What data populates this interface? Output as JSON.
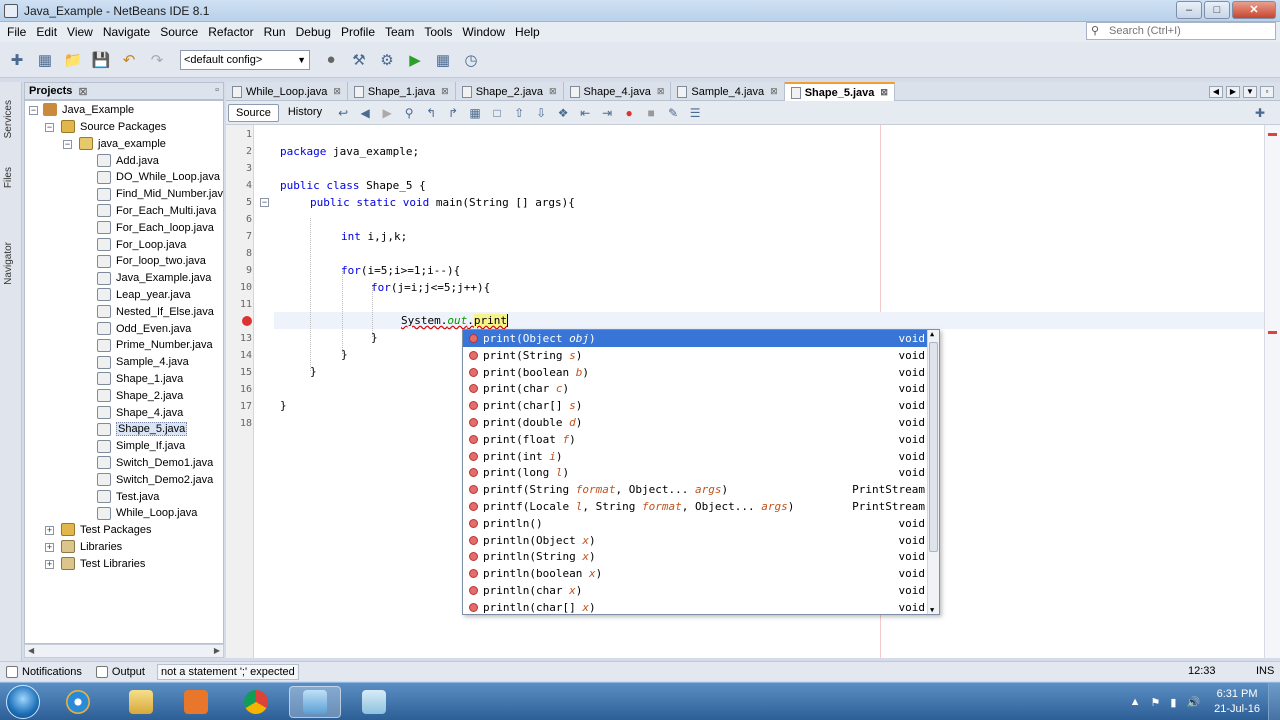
{
  "window": {
    "title": "Java_Example - NetBeans IDE 8.1",
    "min": "‒",
    "max": "□",
    "close": "✕"
  },
  "menu": [
    "File",
    "Edit",
    "View",
    "Navigate",
    "Source",
    "Refactor",
    "Run",
    "Debug",
    "Profile",
    "Team",
    "Tools",
    "Window",
    "Help"
  ],
  "search": {
    "placeholder": "Search (Ctrl+I)"
  },
  "toolbar": {
    "config": "<default config>"
  },
  "side_labels": {
    "services": "Services",
    "files": "Files",
    "navigator": "Navigator"
  },
  "projects": {
    "title": "Projects",
    "root": "Java_Example",
    "source_packages": "Source Packages",
    "package": "java_example",
    "files": [
      "Add.java",
      "DO_While_Loop.java",
      "Find_Mid_Number.java",
      "For_Each_Multi.java",
      "For_Each_loop.java",
      "For_Loop.java",
      "For_loop_two.java",
      "Java_Example.java",
      "Leap_year.java",
      "Nested_If_Else.java",
      "Odd_Even.java",
      "Prime_Number.java",
      "Sample_4.java",
      "Shape_1.java",
      "Shape_2.java",
      "Shape_4.java",
      "Shape_5.java",
      "Simple_If.java",
      "Switch_Demo1.java",
      "Switch_Demo2.java",
      "Test.java",
      "While_Loop.java"
    ],
    "selected_file": "Shape_5.java",
    "test_packages": "Test Packages",
    "libraries": "Libraries",
    "test_libraries": "Test Libraries"
  },
  "tabs": [
    "While_Loop.java",
    "Shape_1.java",
    "Shape_2.java",
    "Shape_4.java",
    "Sample_4.java",
    "Shape_5.java"
  ],
  "active_tab": "Shape_5.java",
  "editor": {
    "source_btn": "Source",
    "history_btn": "History",
    "line_numbers": [
      "1",
      "2",
      "3",
      "4",
      "5",
      "6",
      "7",
      "8",
      "9",
      "10",
      "11",
      "",
      "13",
      "14",
      "15",
      "16",
      "17",
      "18"
    ],
    "lines": {
      "l2": {
        "kw": "package",
        "rest": " java_example;"
      },
      "l4": {
        "kw": "public class",
        "name": " Shape_5 ",
        "brace": "{"
      },
      "l5": {
        "kw": "public static void",
        "name": " main",
        "rest": "(String [] args){"
      },
      "l7": {
        "kw": "int",
        "rest": " i,j,k;"
      },
      "l9": {
        "kw": "for",
        "rest": "(i=5;i>=1;i--){"
      },
      "l10": {
        "kw": "for",
        "rest": "(j=i;j<=5;j++){"
      },
      "l12": {
        "sys": "System.",
        "field": "out",
        "dot": ".",
        "typed": "print"
      },
      "l13": "}",
      "l14": "}",
      "l15": "}",
      "l17": "}"
    }
  },
  "completion": [
    {
      "name": "print",
      "params": [
        [
          "Object",
          "obj"
        ]
      ],
      "ret": "void"
    },
    {
      "name": "print",
      "params": [
        [
          "String",
          "s"
        ]
      ],
      "ret": "void"
    },
    {
      "name": "print",
      "params": [
        [
          "boolean",
          "b"
        ]
      ],
      "ret": "void"
    },
    {
      "name": "print",
      "params": [
        [
          "char",
          "c"
        ]
      ],
      "ret": "void"
    },
    {
      "name": "print",
      "params": [
        [
          "char[]",
          "s"
        ]
      ],
      "ret": "void"
    },
    {
      "name": "print",
      "params": [
        [
          "double",
          "d"
        ]
      ],
      "ret": "void"
    },
    {
      "name": "print",
      "params": [
        [
          "float",
          "f"
        ]
      ],
      "ret": "void"
    },
    {
      "name": "print",
      "params": [
        [
          "int",
          "i"
        ]
      ],
      "ret": "void"
    },
    {
      "name": "print",
      "params": [
        [
          "long",
          "l"
        ]
      ],
      "ret": "void"
    },
    {
      "name": "printf",
      "params": [
        [
          "String",
          "format"
        ],
        [
          "Object...",
          "args"
        ]
      ],
      "ret": "PrintStream"
    },
    {
      "name": "printf",
      "params": [
        [
          "Locale",
          "l"
        ],
        [
          "String",
          "format"
        ],
        [
          "Object...",
          "args"
        ]
      ],
      "ret": "PrintStream"
    },
    {
      "name": "println",
      "params": [],
      "ret": "void"
    },
    {
      "name": "println",
      "params": [
        [
          "Object",
          "x"
        ]
      ],
      "ret": "void"
    },
    {
      "name": "println",
      "params": [
        [
          "String",
          "x"
        ]
      ],
      "ret": "void"
    },
    {
      "name": "println",
      "params": [
        [
          "boolean",
          "x"
        ]
      ],
      "ret": "void"
    },
    {
      "name": "println",
      "params": [
        [
          "char",
          "x"
        ]
      ],
      "ret": "void"
    },
    {
      "name": "println",
      "params": [
        [
          "char[]",
          "x"
        ]
      ],
      "ret": "void"
    }
  ],
  "status": {
    "notifications": "Notifications",
    "output": "Output",
    "message": "not a statement ';' expected",
    "position": "12:33",
    "mode": "INS"
  },
  "clock": {
    "time": "6:31 PM",
    "date": "21-Jul-16"
  }
}
